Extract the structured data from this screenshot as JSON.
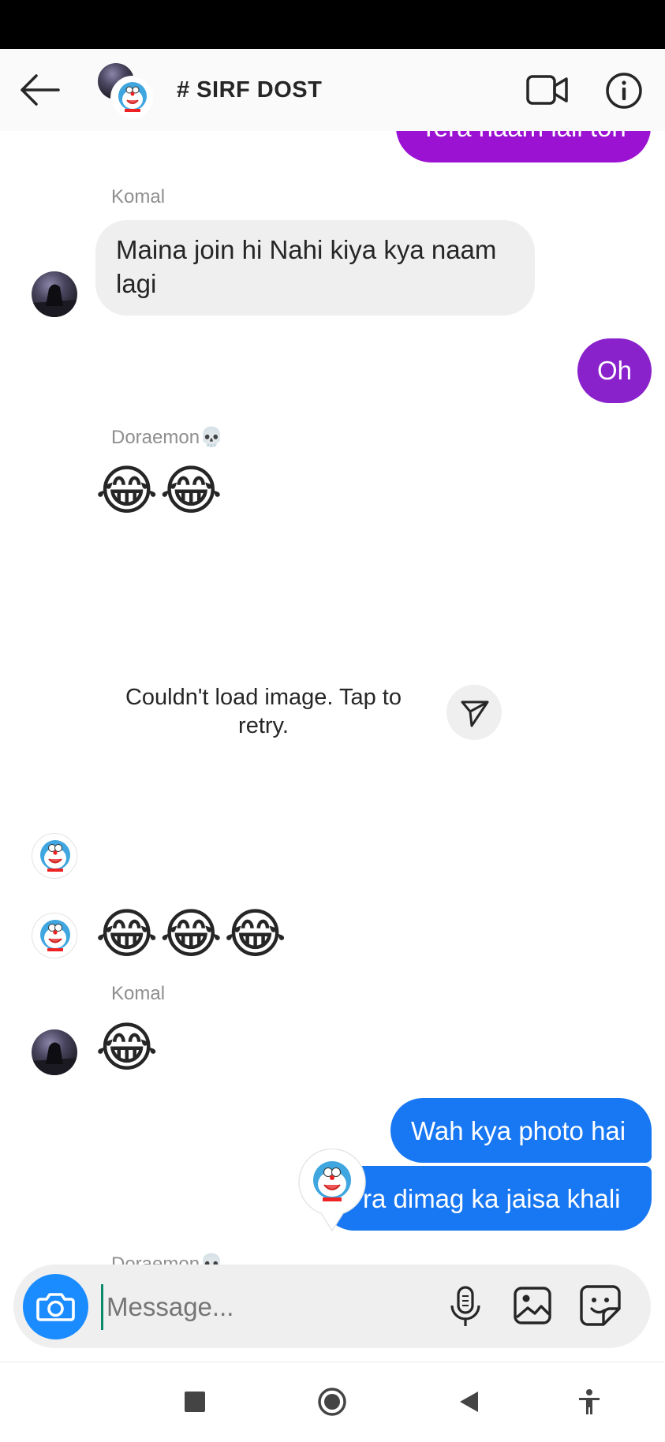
{
  "header": {
    "title": "# SIRF DOST"
  },
  "messages": {
    "top_partial_text": "Tera naam lali toh",
    "komal_1_sender": "Komal",
    "komal_1_text": "Maina join hi Nahi kiya kya naam lagi",
    "out_oh_text": "Oh",
    "doraemon_sender": "Doraemon💀",
    "doraemon_emoji_1": "😂😂",
    "image_error_text": "Couldn't load image. Tap to retry.",
    "doraemon_emoji_2": "😂😂😂",
    "komal_2_sender": "Komal",
    "komal_2_emoji": "😂",
    "out_blue_1": "Wah kya photo hai",
    "out_blue_2": "ra dimag ka jaisa khali",
    "bottom_partial_sender": "Doraemon💀"
  },
  "composer": {
    "placeholder": "Message..."
  },
  "colors": {
    "accent_blue": "#1877f2",
    "purple_top": "#9b12d3",
    "purple_oh": "#8a22cc",
    "camera_blue": "#1a8cff"
  },
  "icons": {
    "back": "arrow-left-icon",
    "video": "video-camera-icon",
    "info": "info-icon",
    "camera": "camera-icon",
    "mic": "microphone-icon",
    "gallery": "image-icon",
    "sticker": "sticker-icon",
    "share": "send-icon"
  }
}
